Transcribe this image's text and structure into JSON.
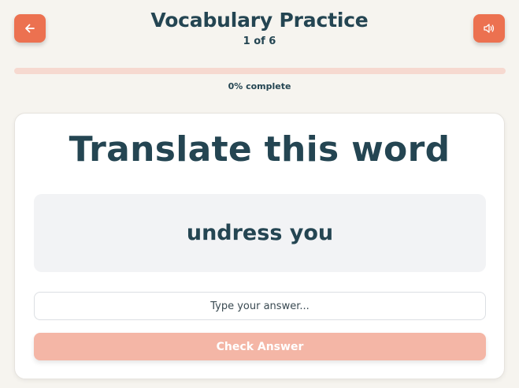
{
  "header": {
    "title": "Vocabulary Practice",
    "counter": "1 of 6",
    "back_icon": "arrow-left-icon",
    "sound_icon": "speaker-icon"
  },
  "progress": {
    "value": 0,
    "label": "0% complete"
  },
  "card": {
    "title": "Translate this word",
    "word": "undress you",
    "input": {
      "value": "",
      "placeholder": "Type your answer..."
    },
    "check_label": "Check Answer"
  },
  "colors": {
    "accent": "#ec7150",
    "accent_disabled": "#f4b6a6",
    "progress_track": "#f6d9d0",
    "text_dark": "#244552",
    "background": "#f6f4ef"
  }
}
